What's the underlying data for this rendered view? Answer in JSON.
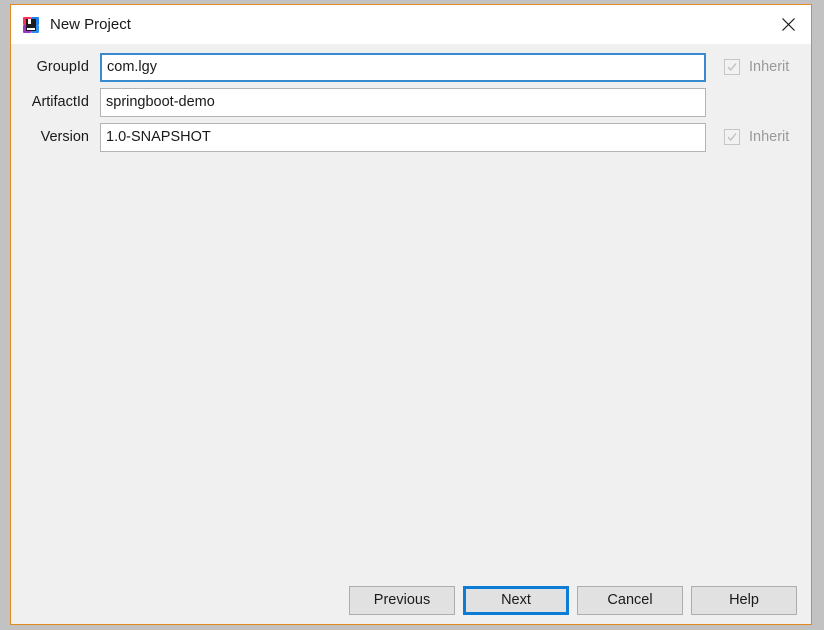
{
  "window": {
    "title": "New Project",
    "app_icon": "intellij-idea-icon",
    "close_icon": "close-icon",
    "border_color": "#e08a20",
    "accent_color": "#0c7cd5",
    "titlebar_bg": "#ffffff",
    "content_bg": "#f0f0f0"
  },
  "form": {
    "fields": [
      {
        "label": "GroupId",
        "value": "com.lgy",
        "placeholder": "",
        "focused": true,
        "has_inherit": true,
        "inherit_label": "Inherit",
        "inherit_checked": true,
        "inherit_enabled": false
      },
      {
        "label": "ArtifactId",
        "value": "springboot-demo",
        "placeholder": "",
        "focused": false,
        "has_inherit": false,
        "inherit_label": "",
        "inherit_checked": false,
        "inherit_enabled": false
      },
      {
        "label": "Version",
        "value": "1.0-SNAPSHOT",
        "placeholder": "",
        "focused": false,
        "has_inherit": true,
        "inherit_label": "Inherit",
        "inherit_checked": true,
        "inherit_enabled": false
      }
    ]
  },
  "buttons": {
    "previous": "Previous",
    "next": "Next",
    "cancel": "Cancel",
    "help": "Help"
  }
}
